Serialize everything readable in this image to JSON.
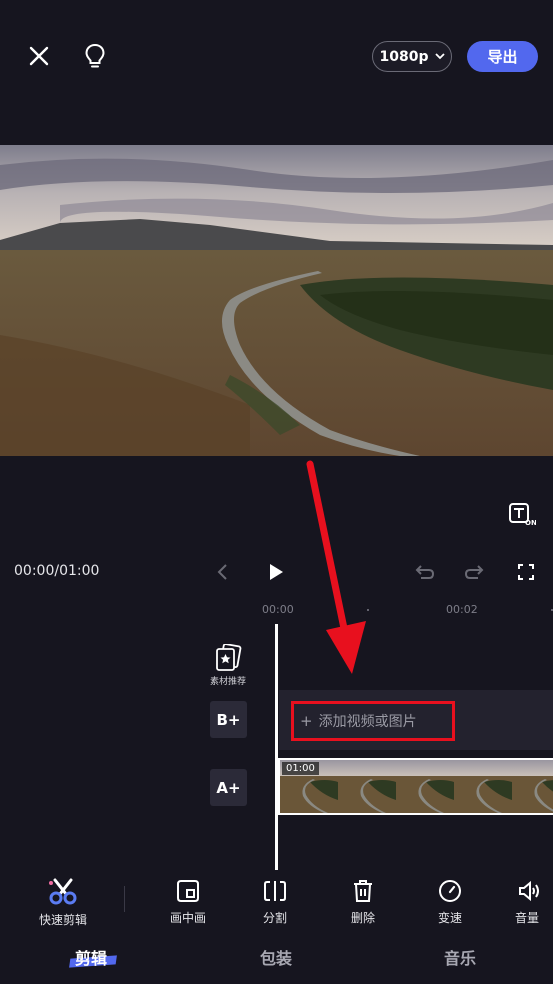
{
  "topbar": {
    "resolution": "1080p",
    "export_label": "导出"
  },
  "transport": {
    "timecode": "00:00/01:00"
  },
  "ruler": {
    "ticks": [
      "00:00",
      "00:02"
    ]
  },
  "tracks": {
    "material_label": "素材推荐",
    "b_label": "B+",
    "a_label": "A+",
    "add_prefix": "+",
    "add_label": "添加视频或图片",
    "clip_duration": "01:00"
  },
  "toolbar": {
    "quick_edit": "快速剪辑",
    "pip": "画中画",
    "split": "分割",
    "delete": "删除",
    "speed": "变速",
    "volume": "音量"
  },
  "tabs": {
    "edit": "剪辑",
    "package": "包装",
    "music": "音乐"
  },
  "colors": {
    "accent": "#5268ee",
    "highlight": "#e8101e",
    "background": "#16151f"
  }
}
